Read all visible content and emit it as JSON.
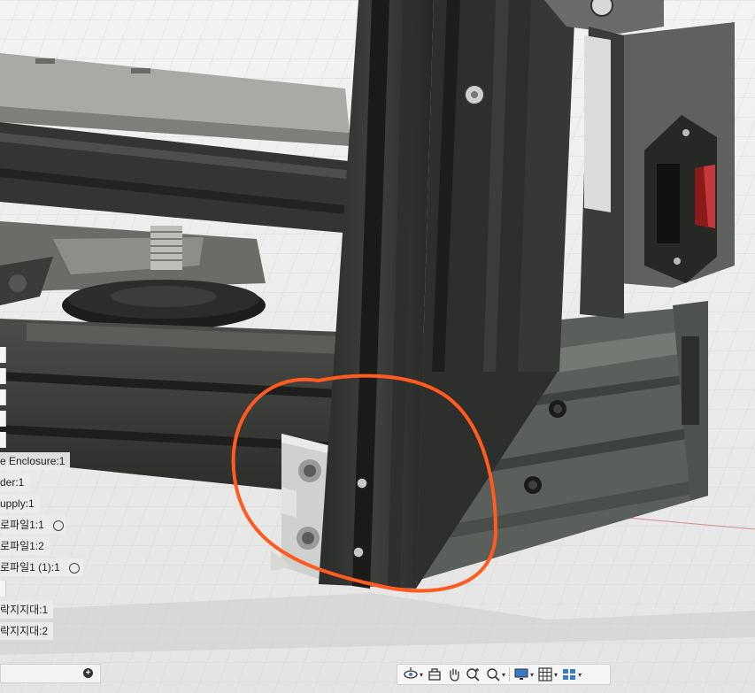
{
  "app": {
    "name": "Fusion 360 design viewport",
    "annotation_color": "#ff5a1f"
  },
  "browser": {
    "items": [
      {
        "label": "e Enclosure:1",
        "has_visibility_toggle": false
      },
      {
        "label": "der:1",
        "has_visibility_toggle": false
      },
      {
        "label": "upply:1",
        "has_visibility_toggle": false
      },
      {
        "label": "로파일1:1",
        "has_visibility_toggle": true
      },
      {
        "label": "로파일1:2",
        "has_visibility_toggle": false
      },
      {
        "label": "로파일1 (1):1",
        "has_visibility_toggle": true
      },
      {
        "label": "",
        "has_visibility_toggle": false
      },
      {
        "label": "락지지대:1",
        "has_visibility_toggle": false
      },
      {
        "label": "락지지대:2",
        "has_visibility_toggle": false
      }
    ]
  },
  "bottom_bar": {
    "add_icon": "plus-circle-icon"
  },
  "navigation_toolbar": {
    "buttons": [
      {
        "name": "orbit",
        "icon": "orbit-icon",
        "has_dropdown": true
      },
      {
        "name": "look-at",
        "icon": "look-at-icon",
        "has_dropdown": false
      },
      {
        "name": "pan",
        "icon": "hand-pan-icon",
        "has_dropdown": false
      },
      {
        "name": "zoom",
        "icon": "zoom-icon",
        "has_dropdown": false
      },
      {
        "name": "fit",
        "icon": "zoom-window-icon",
        "has_dropdown": true
      },
      {
        "name": "display-settings",
        "icon": "monitor-icon",
        "has_dropdown": true
      },
      {
        "name": "grid-and-snaps",
        "icon": "grid-icon",
        "has_dropdown": true
      },
      {
        "name": "viewports",
        "icon": "viewports-icon",
        "has_dropdown": true
      }
    ]
  }
}
